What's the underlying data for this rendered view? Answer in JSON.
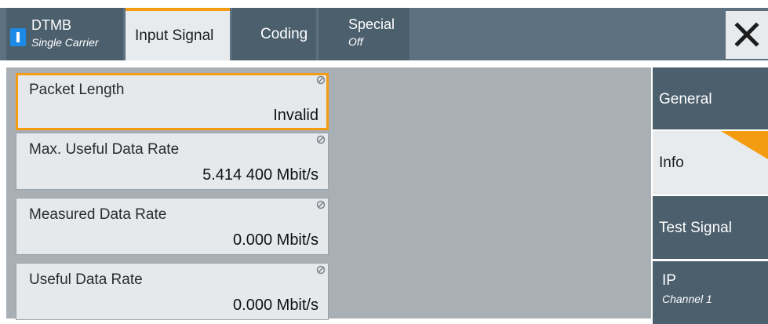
{
  "tabs": {
    "dtmb": {
      "title": "DTMB",
      "subtitle": "Single Carrier"
    },
    "input_signal": {
      "title": "Input Signal"
    },
    "coding": {
      "title": "Coding"
    },
    "special": {
      "title": "Special",
      "subtitle": "Off"
    }
  },
  "close_icon": "close-x-icon",
  "fields": [
    {
      "label": "Packet Length",
      "value": "Invalid"
    },
    {
      "label": "Max. Useful Data Rate",
      "value": "5.414 400 Mbit/s"
    },
    {
      "label": "Measured Data Rate",
      "value": "0.000 Mbit/s"
    },
    {
      "label": "Useful Data Rate",
      "value": "0.000 Mbit/s"
    }
  ],
  "side_nav": {
    "general": {
      "label": "General"
    },
    "info": {
      "label": "Info"
    },
    "test_signal": {
      "label": "Test Signal"
    },
    "ip": {
      "label": "IP",
      "sublabel": "Channel 1"
    }
  },
  "colors": {
    "accent": "#f39c12",
    "tab_dark": "#4b5f6d",
    "badge_blue": "#1c8ae6"
  }
}
